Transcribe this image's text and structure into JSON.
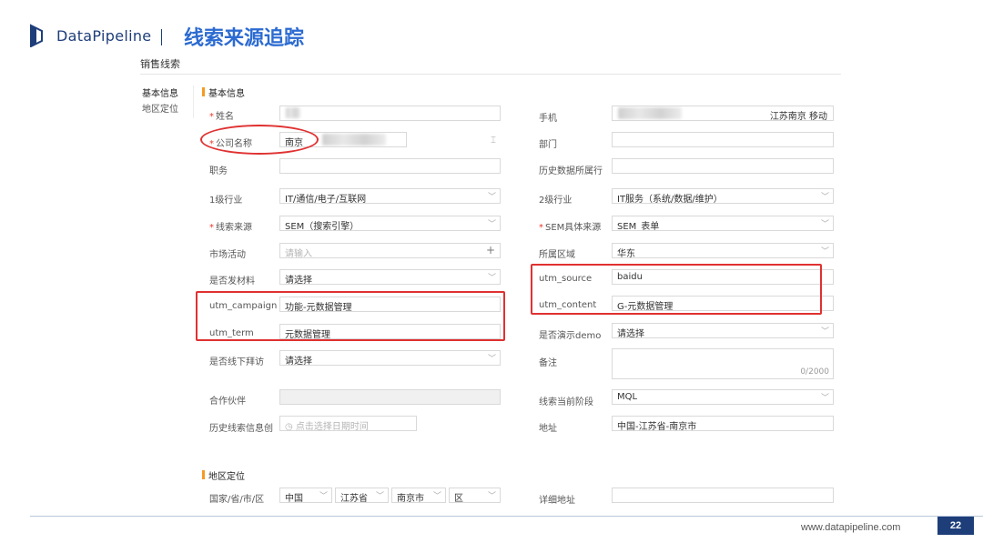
{
  "header": {
    "brand": "DataPipeline",
    "divider": "|",
    "slide_title": "线索来源追踪"
  },
  "app": {
    "title": "销售线索",
    "tabs": [
      "基本信息",
      "地区定位"
    ]
  },
  "sections": {
    "basic": "基本信息",
    "region": "地区定位"
  },
  "form": {
    "left": {
      "name": {
        "label": "姓名"
      },
      "company": {
        "label": "公司名称",
        "value": "南京"
      },
      "title": {
        "label": "职务"
      },
      "industry1": {
        "label": "1级行业",
        "value": "IT/通信/电子/互联网"
      },
      "lead_source": {
        "label": "线索来源",
        "value": "SEM（搜索引擎）"
      },
      "campaign": {
        "label": "市场活动",
        "placeholder": "请输入"
      },
      "send_material": {
        "label": "是否发材料",
        "value": "请选择"
      },
      "utm_campaign": {
        "label": "utm_campaign",
        "value": "功能-元数据管理"
      },
      "utm_term": {
        "label": "utm_term",
        "value": "元数据管理"
      },
      "offline_visit": {
        "label": "是否线下拜访",
        "value": "请选择"
      },
      "partner": {
        "label": "合作伙伴"
      },
      "hist_created": {
        "label": "历史线索信息创",
        "placeholder": "点击选择日期时间"
      }
    },
    "right": {
      "phone": {
        "label": "手机",
        "carrier": "江苏南京 移动"
      },
      "dept": {
        "label": "部门"
      },
      "hist_industry": {
        "label": "历史数据所属行"
      },
      "industry2": {
        "label": "2级行业",
        "value": "IT服务（系统/数据/维护）"
      },
      "sem_source": {
        "label": "SEM具体来源",
        "value": "SEM_表单"
      },
      "area": {
        "label": "所属区域",
        "value": "华东"
      },
      "utm_source": {
        "label": "utm_source",
        "value": "baidu"
      },
      "utm_content": {
        "label": "utm_content",
        "value": "G-元数据管理"
      },
      "demo": {
        "label": "是否演示demo",
        "value": "请选择"
      },
      "remark": {
        "label": "备注",
        "count": "0/2000"
      },
      "stage": {
        "label": "线索当前阶段",
        "value": "MQL"
      },
      "address": {
        "label": "地址",
        "value": "中国-江苏省-南京市"
      }
    },
    "region": {
      "label": "国家/省/市/区",
      "country": "中国",
      "province": "江苏省",
      "city": "南京市",
      "district": "区",
      "detail_label": "详细地址"
    }
  },
  "footer": {
    "url": "www.datapipeline.com",
    "page": "22"
  },
  "colors": {
    "brand": "#1e3e7a",
    "title": "#2c6bd1",
    "highlight": "#e03131",
    "section_bar": "#f59b23",
    "required": "#e8392d"
  }
}
